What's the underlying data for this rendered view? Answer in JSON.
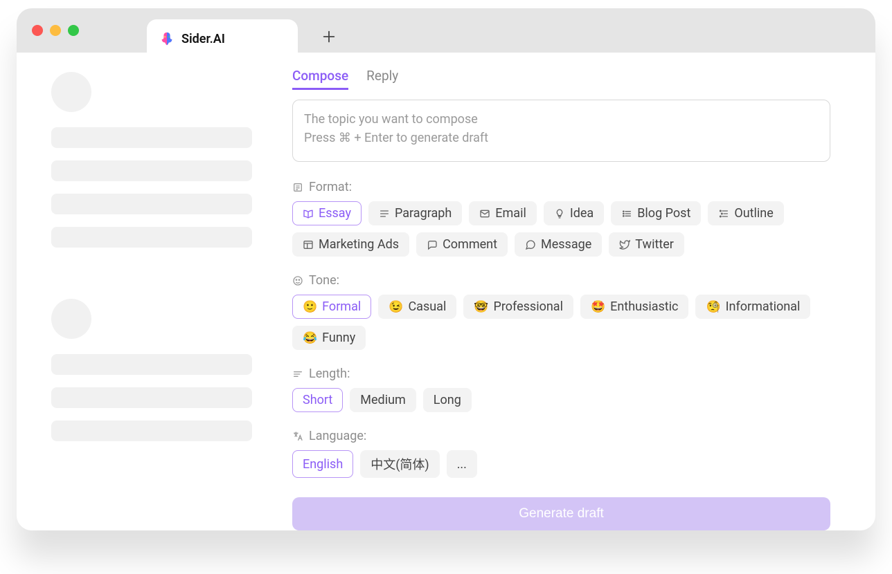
{
  "tab": {
    "title": "Sider.AI"
  },
  "modes": {
    "compose": "Compose",
    "reply": "Reply",
    "active": "compose"
  },
  "textarea": {
    "placeholder_line1": "The topic you want to compose",
    "placeholder_line2": "Press ⌘ + Enter to generate draft"
  },
  "sections": {
    "format": "Format:",
    "tone": "Tone:",
    "length": "Length:",
    "language": "Language:"
  },
  "format": {
    "selected": "Essay",
    "options": [
      {
        "label": "Essay",
        "icon": "book-open-icon"
      },
      {
        "label": "Paragraph",
        "icon": "paragraph-icon"
      },
      {
        "label": "Email",
        "icon": "mail-icon"
      },
      {
        "label": "Idea",
        "icon": "lightbulb-icon"
      },
      {
        "label": "Blog Post",
        "icon": "list-bullets-icon"
      },
      {
        "label": "Outline",
        "icon": "outline-icon"
      },
      {
        "label": "Marketing Ads",
        "icon": "layout-icon"
      },
      {
        "label": "Comment",
        "icon": "comment-icon"
      },
      {
        "label": "Message",
        "icon": "message-icon"
      },
      {
        "label": "Twitter",
        "icon": "twitter-icon"
      }
    ]
  },
  "tone": {
    "selected": "Formal",
    "options": [
      {
        "label": "Formal",
        "emoji": "🙂"
      },
      {
        "label": "Casual",
        "emoji": "😉"
      },
      {
        "label": "Professional",
        "emoji": "🤓"
      },
      {
        "label": "Enthusiastic",
        "emoji": "🤩"
      },
      {
        "label": "Informational",
        "emoji": "🧐"
      },
      {
        "label": "Funny",
        "emoji": "😂"
      }
    ]
  },
  "length": {
    "selected": "Short",
    "options": [
      "Short",
      "Medium",
      "Long"
    ]
  },
  "language": {
    "selected": "English",
    "options": [
      "English",
      "中文(简体)",
      "..."
    ]
  },
  "generate_button": "Generate draft",
  "colors": {
    "accent": "#8b5cf6",
    "accent_light": "#d3c4f6"
  }
}
